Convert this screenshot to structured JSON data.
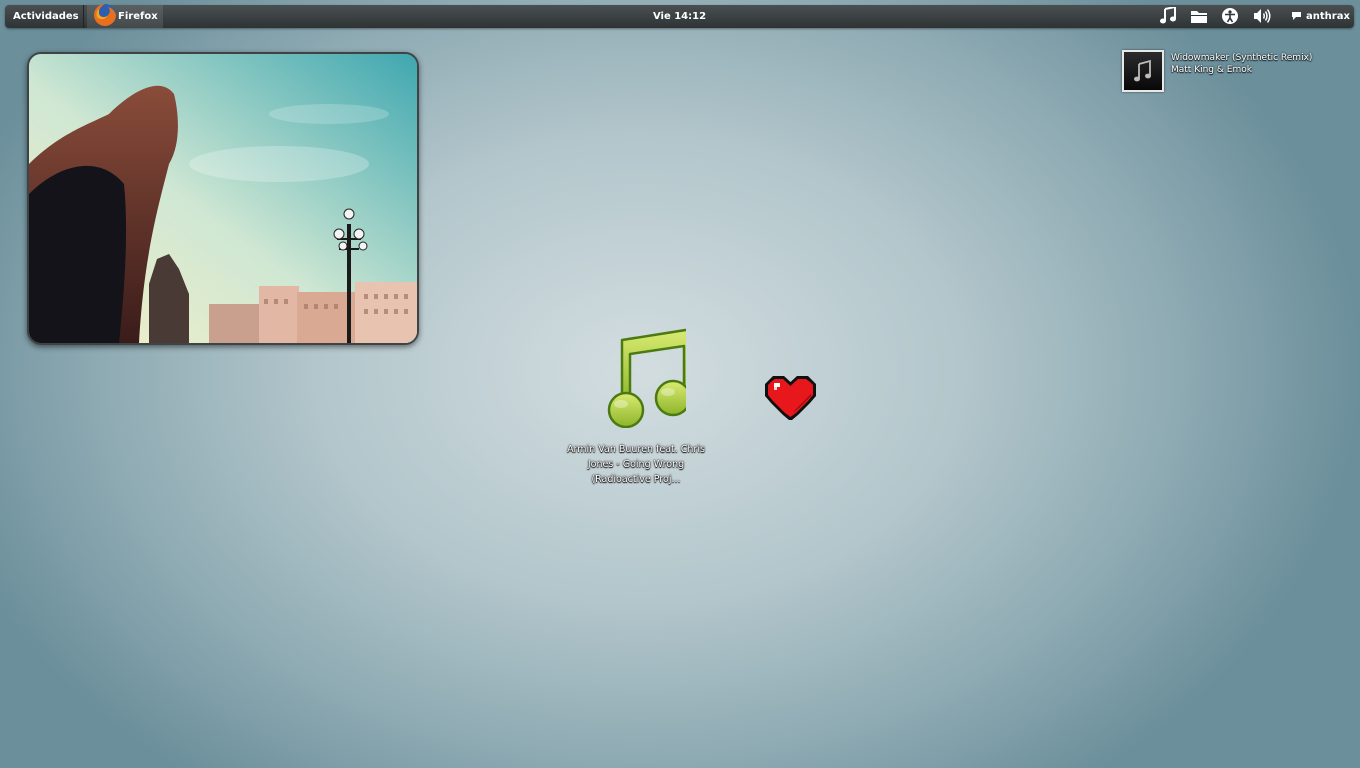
{
  "top_panel": {
    "activities_label": "Actividades",
    "running_app": {
      "label": "Firefox",
      "icon": "firefox-icon"
    },
    "clock": "Vie 14:12",
    "tray_icons": [
      "music-note-icon",
      "folder-icon",
      "accessibility-icon",
      "volume-icon"
    ],
    "user": {
      "icon": "chat-bubble-icon",
      "name": "anthrax"
    }
  },
  "now_playing": {
    "title": "Widowmaker (Synthetic Remix)",
    "artist": "Matt King & Emok",
    "art_icon": "music-note-icon"
  },
  "desktop": {
    "music_file": {
      "icon": "music-note-icon",
      "label": "Armin Van Buuren feat. Chris Jones - Going Wrong (Radioactive Proj..."
    },
    "heart_icon": "heart-icon",
    "photo_widget": "photo-frame"
  },
  "colors": {
    "panel": "#2e3334",
    "desktop_center": "#d3dde0",
    "desktop_edge": "#6b8f9b",
    "note_green": "#a6c43a",
    "heart_red": "#e8171b"
  }
}
